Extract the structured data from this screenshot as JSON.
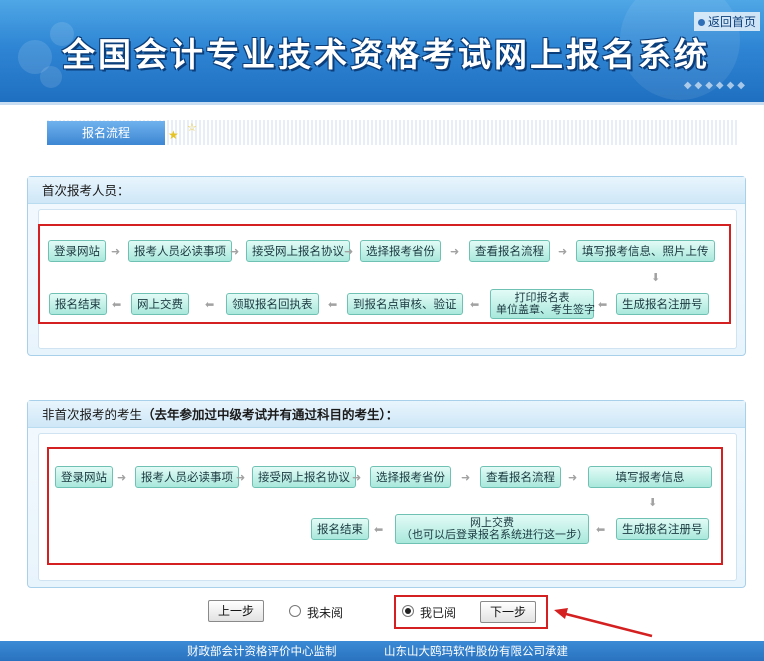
{
  "header": {
    "title": "全国会计专业技术资格考试网上报名系统",
    "back_link": "返回首页"
  },
  "tab": {
    "label": "报名流程"
  },
  "section1": {
    "heading": "首次报考人员：",
    "steps": [
      "登录网站",
      "报考人员必读事项",
      "接受网上报名协议",
      "选择报考省份",
      "查看报名流程",
      "填写报考信息、照片上传",
      "生成报名注册号",
      "打印报名表",
      "单位盖章、考生签字",
      "到报名点审核、验证",
      "领取报名回执表",
      "网上交费",
      "报名结束"
    ]
  },
  "section2": {
    "heading": "非首次报考的考生",
    "heading_note": "（去年参加过中级考试并有通过科目的考生）：",
    "steps": [
      "登录网站",
      "报考人员必读事项",
      "接受网上报名协议",
      "选择报考省份",
      "查看报名流程",
      "填写报考信息",
      "生成报名注册号",
      "网上交费",
      "（也可以后登录报名系统进行这一步）",
      "报名结束"
    ]
  },
  "controls": {
    "prev_label": "上一步",
    "not_read_label": "我未阅",
    "read_label": "我已阅",
    "next_label": "下一步",
    "selected": "read"
  },
  "footer": {
    "supervisor": "财政部会计资格评价中心监制",
    "contractor": "山东山大鸥玛软件股份有限公司承建"
  },
  "colors": {
    "banner": "#2f86d4",
    "annotation_red": "#d42020",
    "step_fill": "#a9e8dc"
  }
}
